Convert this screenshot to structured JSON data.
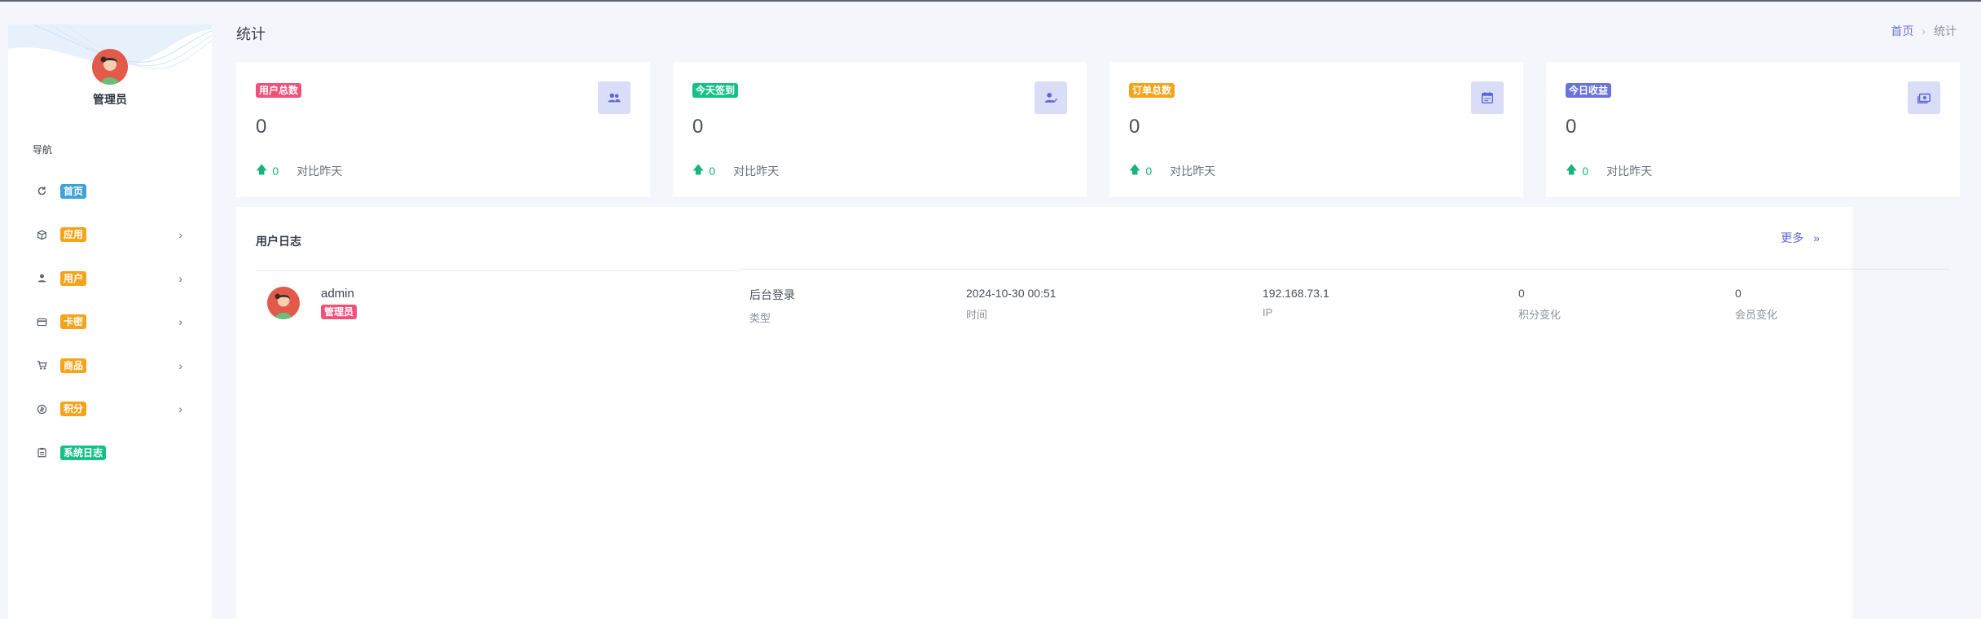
{
  "colors": {
    "accent": "#5f68d1",
    "badge_home": "#3ca3d4",
    "badge_orange": "#f5a31a",
    "badge_green": "#16c08a",
    "badge_red": "#f0517a",
    "badge_indigo": "#6a73d9",
    "trend_up": "#18b37e"
  },
  "sidebar": {
    "profile_name": "管理员",
    "nav_heading": "导航",
    "items": [
      {
        "label": "首页",
        "icon": "refresh-icon",
        "color": "#3ca3d4",
        "expandable": false
      },
      {
        "label": "应用",
        "icon": "cube-icon",
        "color": "#f5a31a",
        "expandable": true
      },
      {
        "label": "用户",
        "icon": "user-icon",
        "color": "#f5a31a",
        "expandable": true
      },
      {
        "label": "卡密",
        "icon": "card-icon",
        "color": "#f5a31a",
        "expandable": true
      },
      {
        "label": "商品",
        "icon": "cart-icon",
        "color": "#f5a31a",
        "expandable": true
      },
      {
        "label": "积分",
        "icon": "coin-icon",
        "color": "#f5a31a",
        "expandable": true
      },
      {
        "label": "系统日志",
        "icon": "clipboard-icon",
        "color": "#16c08a",
        "expandable": false
      }
    ]
  },
  "header": {
    "title": "统计",
    "breadcrumb_home": "首页",
    "breadcrumb_sep": "›",
    "breadcrumb_current": "统计"
  },
  "stats": [
    {
      "label": "用户总数",
      "value": "0",
      "delta": "0",
      "compare": "对比昨天",
      "color": "#f0517a",
      "icon": "users-icon"
    },
    {
      "label": "今天签到",
      "value": "0",
      "delta": "0",
      "compare": "对比昨天",
      "color": "#16c08a",
      "icon": "user-check-icon"
    },
    {
      "label": "订单总数",
      "value": "0",
      "delta": "0",
      "compare": "对比昨天",
      "color": "#f5a31a",
      "icon": "calendar-icon"
    },
    {
      "label": "今日收益",
      "value": "0",
      "delta": "0",
      "compare": "对比昨天",
      "color": "#6a73d9",
      "icon": "cash-icon"
    }
  ],
  "log_panel": {
    "title": "用户日志",
    "more": "更多",
    "more_icon": "»",
    "rows": [
      {
        "user": "admin",
        "role": "管理员",
        "type_value": "后台登录",
        "type_label": "类型",
        "time_value": "2024-10-30 00:51",
        "time_label": "时间",
        "ip_value": "192.168.73.1",
        "ip_label": "IP",
        "points_value": "0",
        "points_label": "积分变化",
        "member_value": "0",
        "member_label": "会员变化"
      }
    ]
  }
}
